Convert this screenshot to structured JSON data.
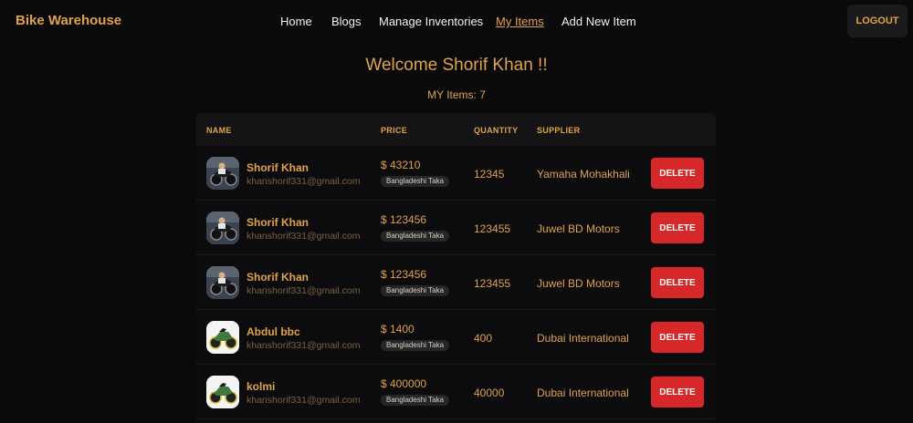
{
  "brand": "Bike Warehouse",
  "nav": {
    "home": "Home",
    "blogs": "Blogs",
    "manage": "Manage Inventories",
    "my_items": "My Items",
    "add_new": "Add New Item",
    "logout": "LOGOUT"
  },
  "welcome": "Welcome Shorif Khan !!",
  "items_count": "MY Items: 7",
  "table": {
    "headers": {
      "name": "NAME",
      "price": "PRICE",
      "quantity": "QUANTITY",
      "supplier": "SUPPLIER"
    },
    "rows": [
      {
        "name": "Shorif Khan",
        "email": "khanshorif331@gmail.com",
        "price": "$ 43210",
        "currency": "Bangladeshi Taka",
        "quantity": "12345",
        "supplier": "Yamaha Mohakhali",
        "action": "DELETE",
        "avatar": "dark-bike-rider"
      },
      {
        "name": "Shorif Khan",
        "email": "khanshorif331@gmail.com",
        "price": "$ 123456",
        "currency": "Bangladeshi Taka",
        "quantity": "123455",
        "supplier": "Juwel BD Motors",
        "action": "DELETE",
        "avatar": "dark-bike-rider"
      },
      {
        "name": "Shorif Khan",
        "email": "khanshorif331@gmail.com",
        "price": "$ 123456",
        "currency": "Bangladeshi Taka",
        "quantity": "123455",
        "supplier": "Juwel BD Motors",
        "action": "DELETE",
        "avatar": "dark-bike-rider"
      },
      {
        "name": "Abdul bbc",
        "email": "khanshorif331@gmail.com",
        "price": "$ 1400",
        "currency": "Bangladeshi Taka",
        "quantity": "400",
        "supplier": "Dubai International",
        "action": "DELETE",
        "avatar": "green-sport-bike"
      },
      {
        "name": "kolmi",
        "email": "khanshorif331@gmail.com",
        "price": "$ 400000",
        "currency": "Bangladeshi Taka",
        "quantity": "40000",
        "supplier": "Dubai International",
        "action": "DELETE",
        "avatar": "green-sport-bike"
      }
    ]
  },
  "colors": {
    "accent": "#e0a24a",
    "background": "#0a0a0c",
    "delete": "#d62828"
  }
}
